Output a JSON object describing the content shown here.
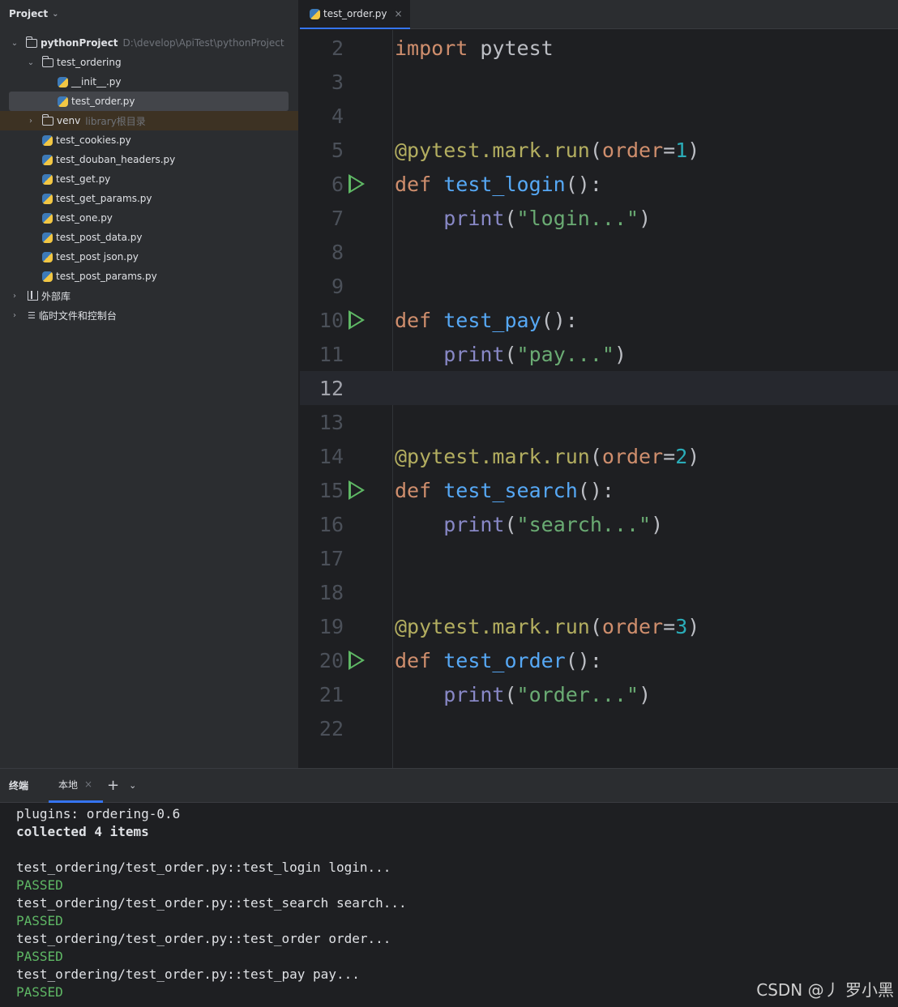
{
  "project_panel": {
    "title": "Project",
    "tree": [
      {
        "label": "pythonProject",
        "path": "D:\\develop\\ApiTest\\pythonProject"
      },
      {
        "label": "test_ordering"
      },
      {
        "label": "__init__.py"
      },
      {
        "label": "test_order.py"
      },
      {
        "label": "venv",
        "note": "library根目录"
      },
      {
        "label": "test_cookies.py"
      },
      {
        "label": "test_douban_headers.py"
      },
      {
        "label": "test_get.py"
      },
      {
        "label": "test_get_params.py"
      },
      {
        "label": "test_one.py"
      },
      {
        "label": "test_post_data.py"
      },
      {
        "label": "test_post json.py"
      },
      {
        "label": "test_post_params.py"
      },
      {
        "label": "外部库"
      },
      {
        "label": "临时文件和控制台"
      }
    ]
  },
  "editor": {
    "tab_label": "test_order.py",
    "current_line": 12,
    "line_numbers": [
      "2",
      "3",
      "4",
      "5",
      "6",
      "7",
      "8",
      "9",
      "10",
      "11",
      "12",
      "13",
      "14",
      "15",
      "16",
      "17",
      "18",
      "19",
      "20",
      "21",
      "22"
    ],
    "run_gutter_lines": [
      6,
      10,
      15,
      20
    ],
    "code": {
      "l2": [
        "import",
        " pytest"
      ],
      "l5": [
        "@pytest.mark.run",
        "(",
        "order",
        "=",
        "1",
        ")"
      ],
      "l6": [
        "def",
        " ",
        "test_login",
        "():"
      ],
      "l7": [
        "    ",
        "print",
        "(",
        "\"login...\"",
        ")"
      ],
      "l10": [
        "def",
        " ",
        "test_pay",
        "():"
      ],
      "l11": [
        "    ",
        "print",
        "(",
        "\"pay...\"",
        ")"
      ],
      "l14": [
        "@pytest.mark.run",
        "(",
        "order",
        "=",
        "2",
        ")"
      ],
      "l15": [
        "def",
        " ",
        "test_search",
        "():"
      ],
      "l16": [
        "    ",
        "print",
        "(",
        "\"search...\"",
        ")"
      ],
      "l19": [
        "@pytest.mark.run",
        "(",
        "order",
        "=",
        "3",
        ")"
      ],
      "l20": [
        "def",
        " ",
        "test_order",
        "():"
      ],
      "l21": [
        "    ",
        "print",
        "(",
        "\"order...\"",
        ")"
      ]
    }
  },
  "terminal": {
    "title": "终端",
    "tab_label": "本地",
    "lines": [
      {
        "text": "plugins: ordering-0.6",
        "style": "normal"
      },
      {
        "text": "collected 4 items",
        "style": "bold"
      },
      {
        "text": "",
        "style": "normal"
      },
      {
        "text": "test_ordering/test_order.py::test_login login...",
        "style": "normal"
      },
      {
        "text": "PASSED",
        "style": "passed"
      },
      {
        "text": "test_ordering/test_order.py::test_search search...",
        "style": "normal"
      },
      {
        "text": "PASSED",
        "style": "passed"
      },
      {
        "text": "test_ordering/test_order.py::test_order order...",
        "style": "normal"
      },
      {
        "text": "PASSED",
        "style": "passed"
      },
      {
        "text": "test_ordering/test_order.py::test_pay pay...",
        "style": "normal"
      },
      {
        "text": "PASSED",
        "style": "passed"
      }
    ]
  },
  "watermark": "CSDN @丿 罗小黑",
  "colors": {
    "accent": "#3574f0",
    "run_green": "#5fb865",
    "keyword": "#cf8e6d",
    "function": "#56a8f5",
    "string": "#6aab73",
    "number": "#2aacb8"
  }
}
